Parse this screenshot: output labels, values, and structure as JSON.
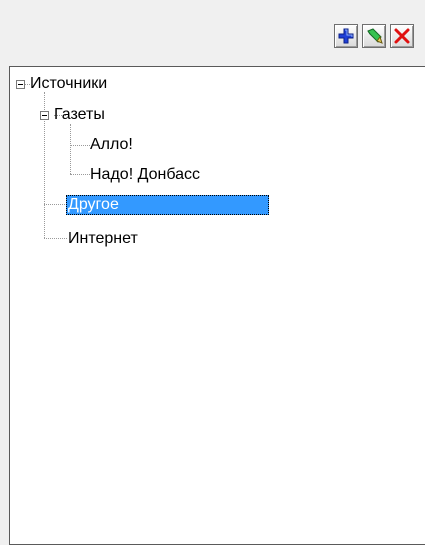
{
  "toolbar": {
    "add_icon": "add-plus-icon",
    "edit_icon": "edit-pencil-icon",
    "delete_icon": "delete-x-icon"
  },
  "tree": {
    "root": {
      "label": "Источники",
      "expanded": true,
      "children": [
        {
          "label": "Газеты",
          "expanded": true,
          "children": [
            {
              "label": "Алло!"
            },
            {
              "label": "Надо! Донбасс"
            }
          ]
        },
        {
          "label": "Другое",
          "selected": true
        },
        {
          "label": "Интернет"
        }
      ]
    }
  },
  "colors": {
    "selection": "#3399ff",
    "add_icon": "#1f3fd6",
    "edit_icon": "#2ea84a",
    "delete_icon": "#e01010"
  }
}
